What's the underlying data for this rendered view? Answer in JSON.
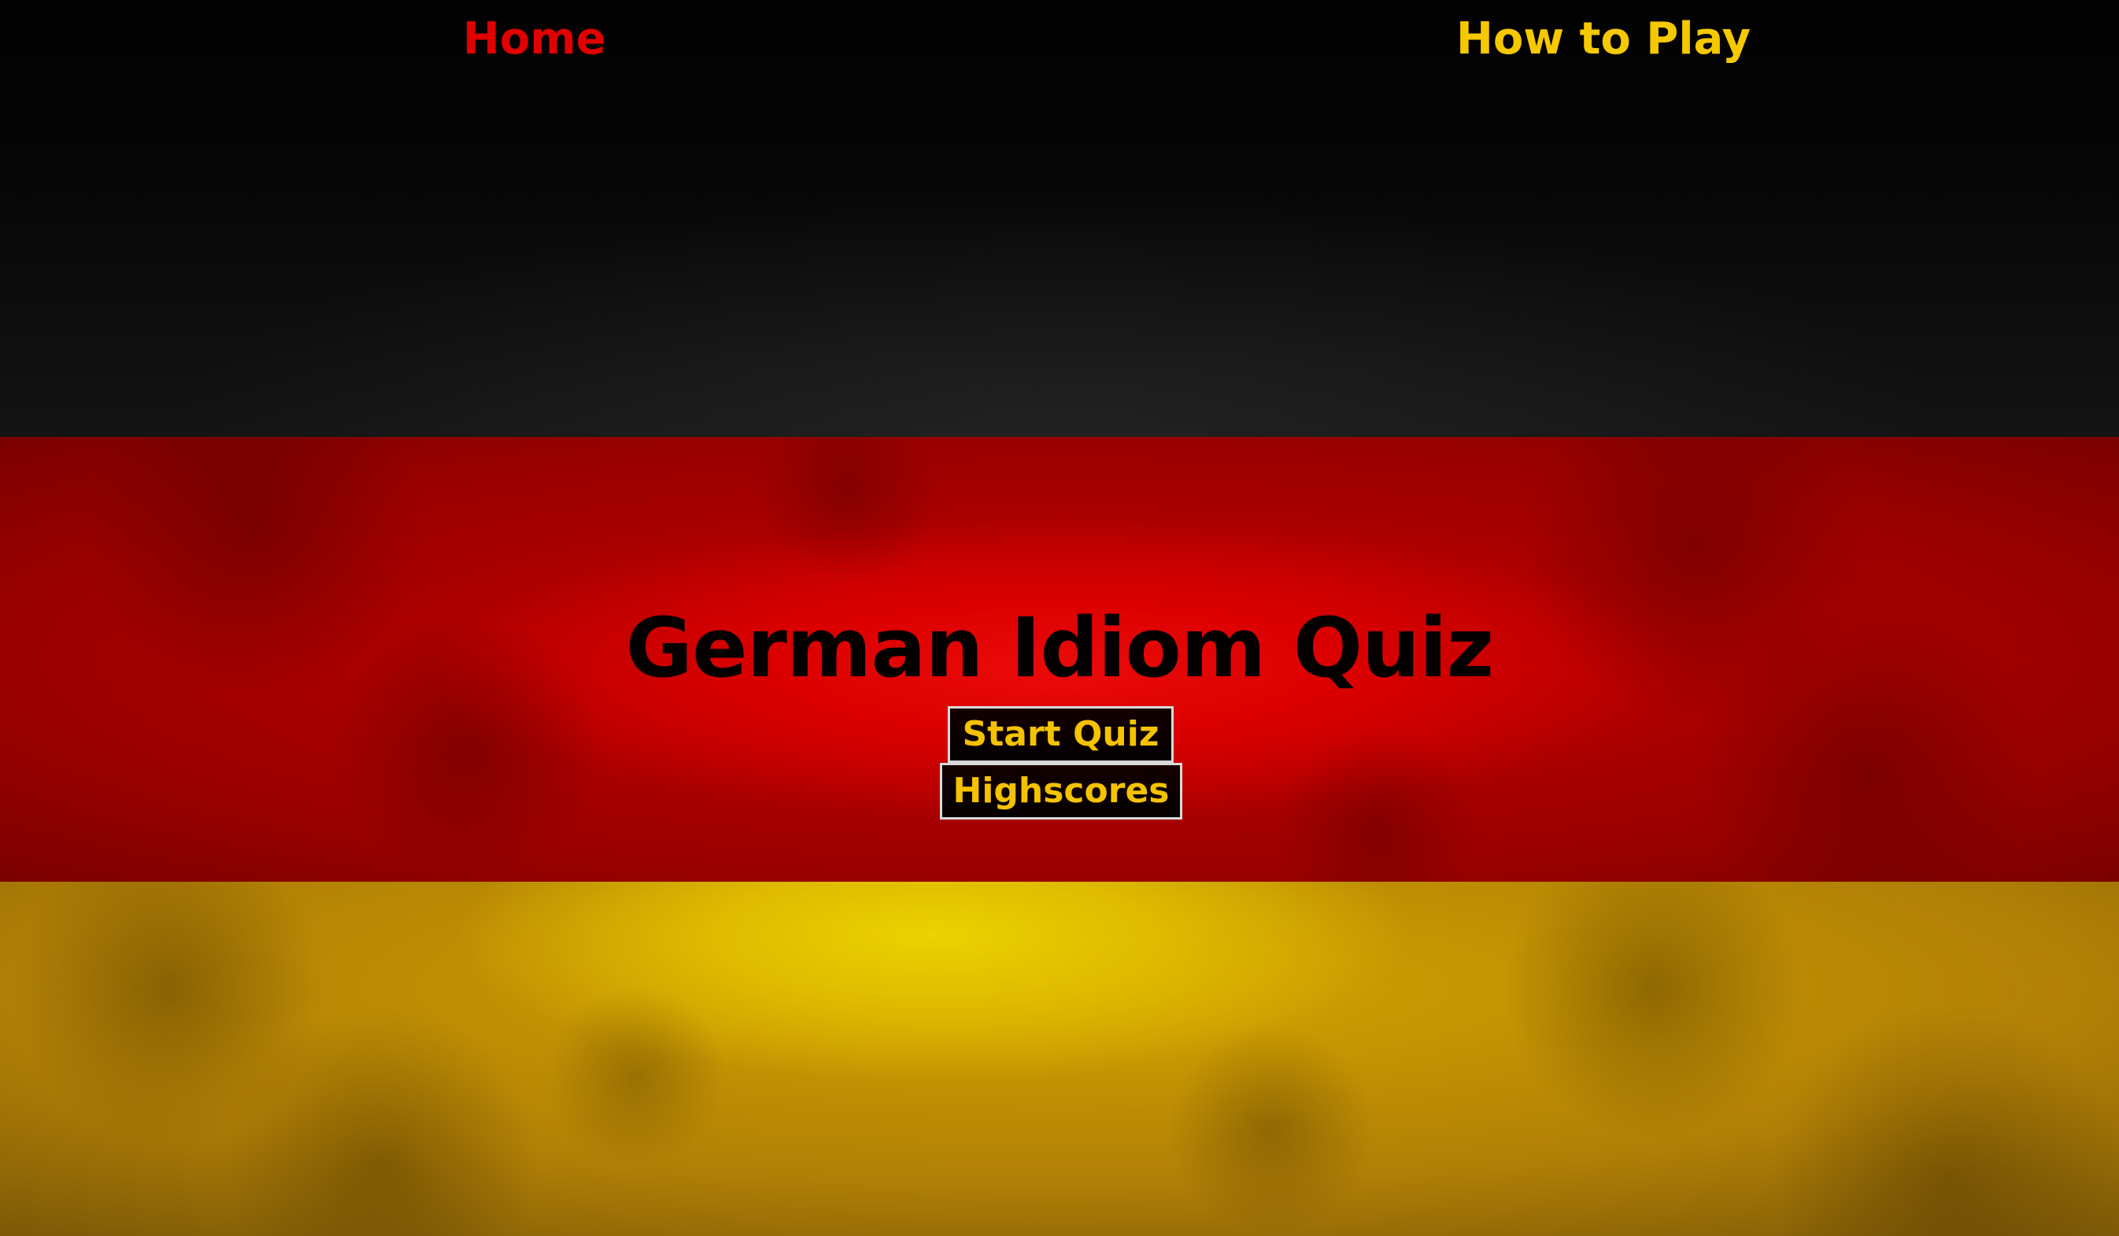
{
  "nav": {
    "home_label": "Home",
    "how_to_play_label": "How to Play"
  },
  "hero": {
    "title": "German Idiom Quiz",
    "start_button": "Start Quiz",
    "highscores_button": "Highscores"
  },
  "colors": {
    "flag_black": "#000000",
    "flag_red": "#dd0000",
    "flag_gold": "#ffce00",
    "nav_home": "#e10000",
    "nav_how_to_play": "#f5c800",
    "button_text": "#f5c200",
    "button_border": "#d9d9d9"
  }
}
